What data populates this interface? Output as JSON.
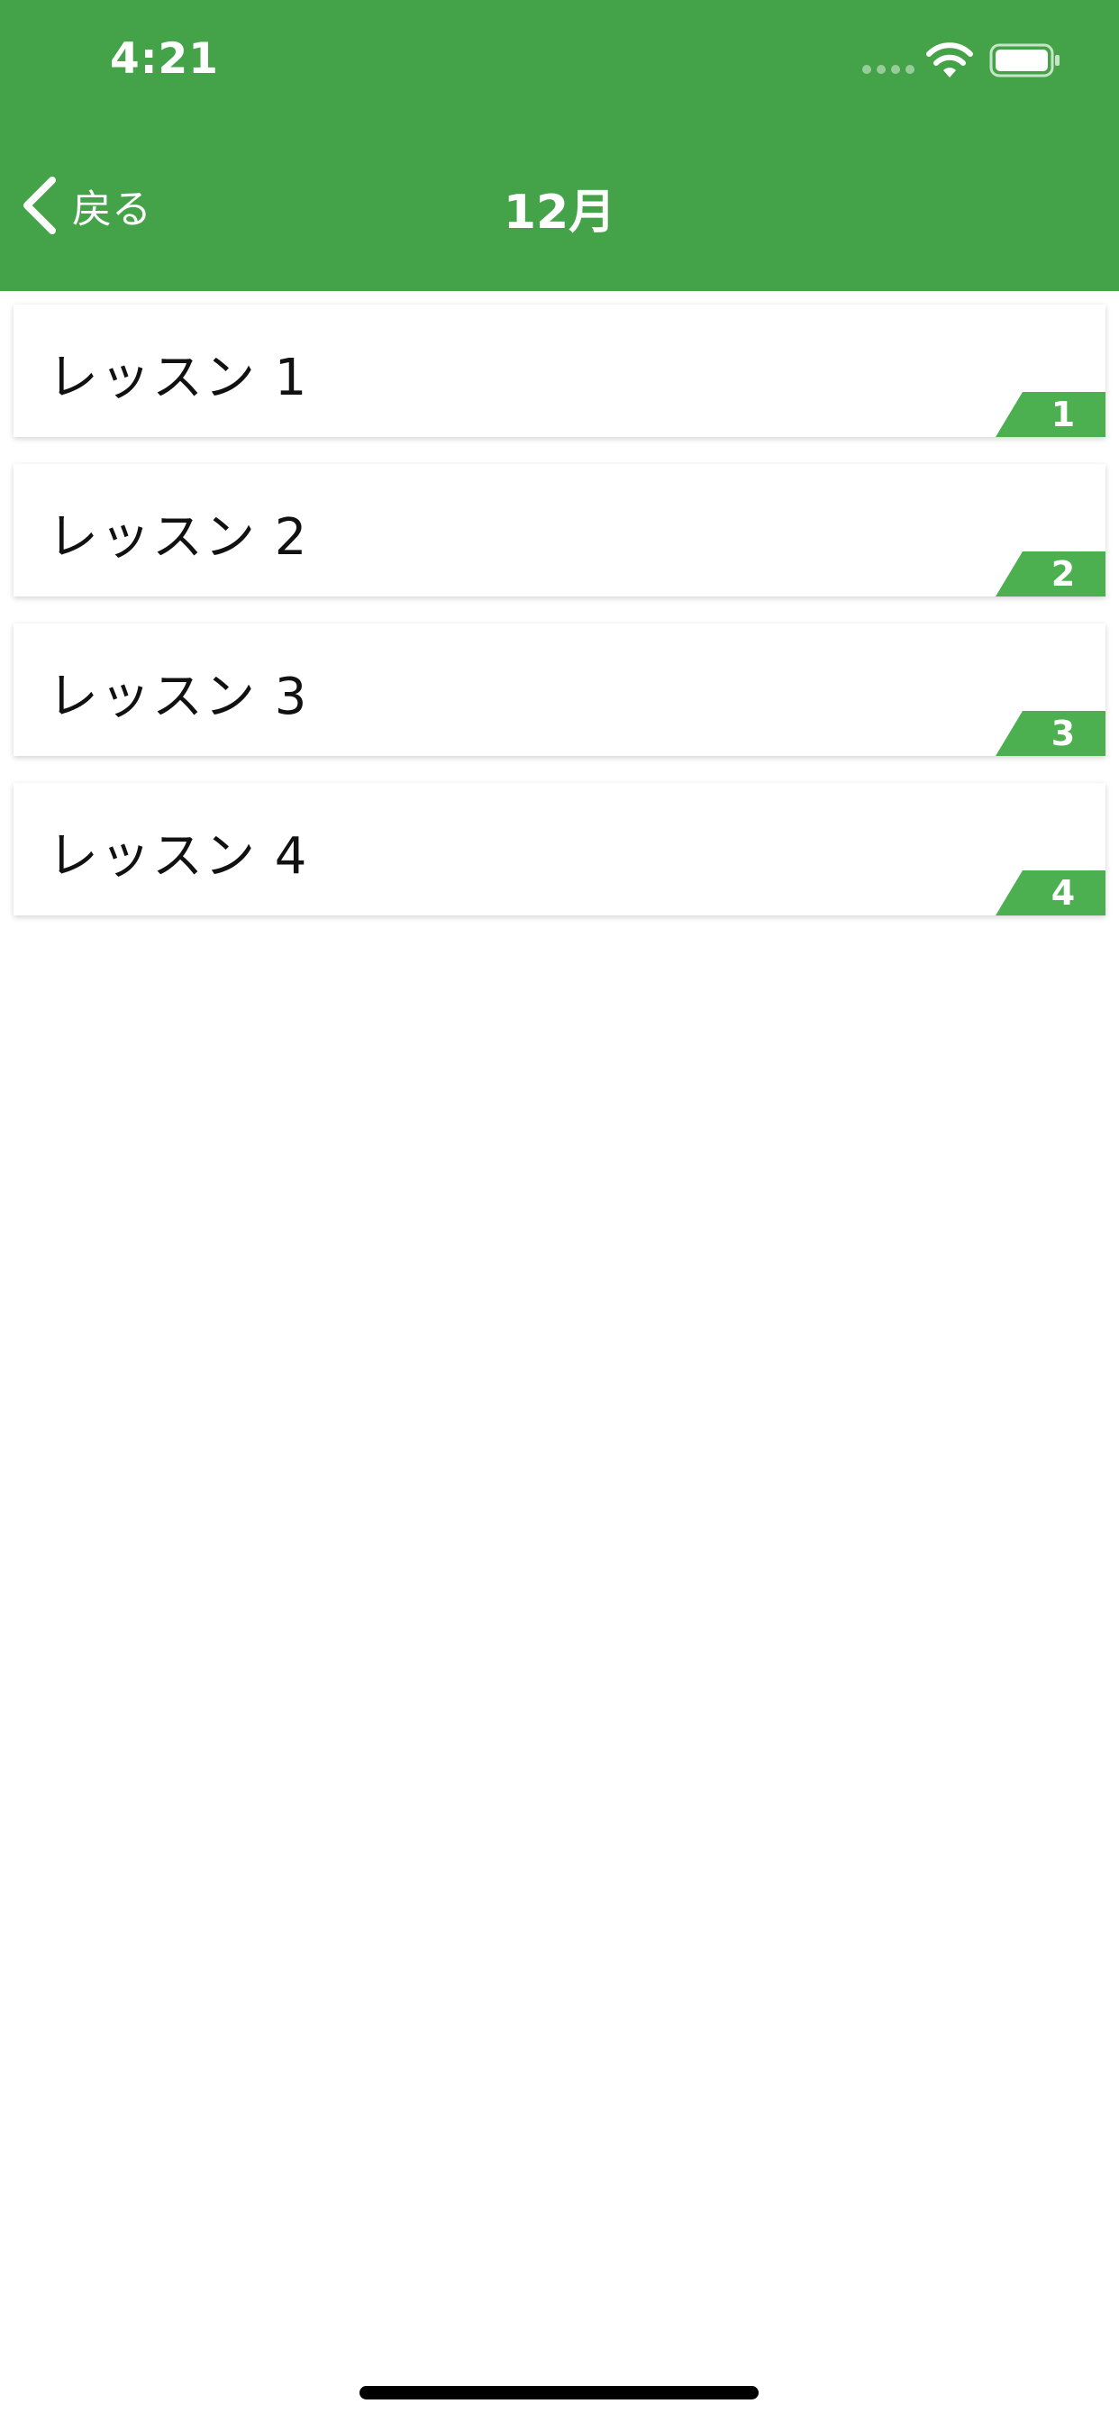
{
  "status_bar": {
    "time": "4:21"
  },
  "nav": {
    "back_label": "戻る",
    "title": "12月"
  },
  "lessons": [
    {
      "title": "レッスン 1",
      "badge": "1"
    },
    {
      "title": "レッスン 2",
      "badge": "2"
    },
    {
      "title": "レッスン 3",
      "badge": "3"
    },
    {
      "title": "レッスン 4",
      "badge": "4"
    }
  ],
  "colors": {
    "header": "#44a348",
    "badge": "#4caf50"
  },
  "icons": {
    "back": "chevron-left-icon",
    "wifi": "wifi-icon",
    "battery": "battery-icon",
    "signal": "signal-icon"
  }
}
